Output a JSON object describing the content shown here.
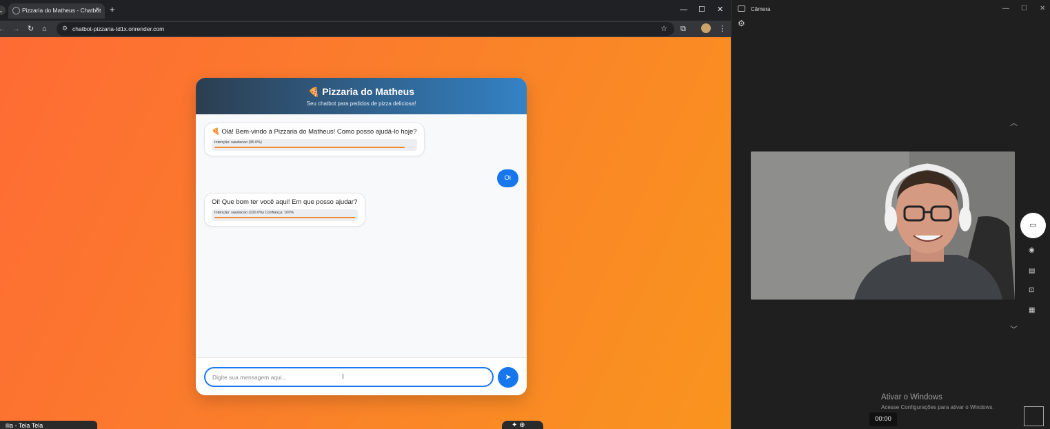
{
  "browser": {
    "tab_title": "Pizzaria do Matheus - Chatbot",
    "tab_close": "×",
    "new_tab": "+",
    "search_tabs_icon": "⌄",
    "controls": {
      "minimize": "—",
      "maximize": "☐",
      "close": "✕"
    },
    "nav": {
      "back": "←",
      "forward": "→",
      "reload": "↻",
      "home": "⌂"
    },
    "site_info_icon": "⚙",
    "url": "chatbot-pizzaria-td1x.onrender.com",
    "star": "☆",
    "extensions": "⧉",
    "menu": "⋮"
  },
  "chat": {
    "header_icon": "🍕",
    "title": "Pizzaria do Matheus",
    "subtitle": "Seu chatbot para pedidos de pizza deliciosa!",
    "messages": [
      {
        "role": "bot",
        "text": "🍕 Olá! Bem-vindo à Pizzaria do Matheus! Como posso ajudá-lo hoje?",
        "intent": "Intenção: saudacao (95.0%)",
        "confidence": 0.95
      },
      {
        "role": "user",
        "text": "Oi"
      },
      {
        "role": "bot",
        "text": "Oi! Que bom ter você aqui! Em que posso ajudar?",
        "intent": "Intenção: saudacao (100.0%) Confiança: 100%",
        "confidence": 1.0
      }
    ],
    "input_placeholder": "Digite sua mensagem aqui...",
    "input_value": "",
    "send_icon": "➤"
  },
  "taskbar": {
    "left_label": "ilia - Tela Tela",
    "center_label": "✦ ⊕"
  },
  "camera": {
    "title": "Câmera",
    "controls": {
      "minimize": "—",
      "maximize": "☐",
      "close": "✕"
    },
    "settings_icon": "⚙",
    "chevron_up": "︿",
    "chevron_down": "﹀",
    "shutter_icon": "▭",
    "side_icons": [
      "◉",
      "▤",
      "⊡",
      "▦"
    ],
    "timer": "00:00",
    "watermark_title": "Ativar o Windows",
    "watermark_sub": "Acesse Configurações para ativar o Windows."
  }
}
